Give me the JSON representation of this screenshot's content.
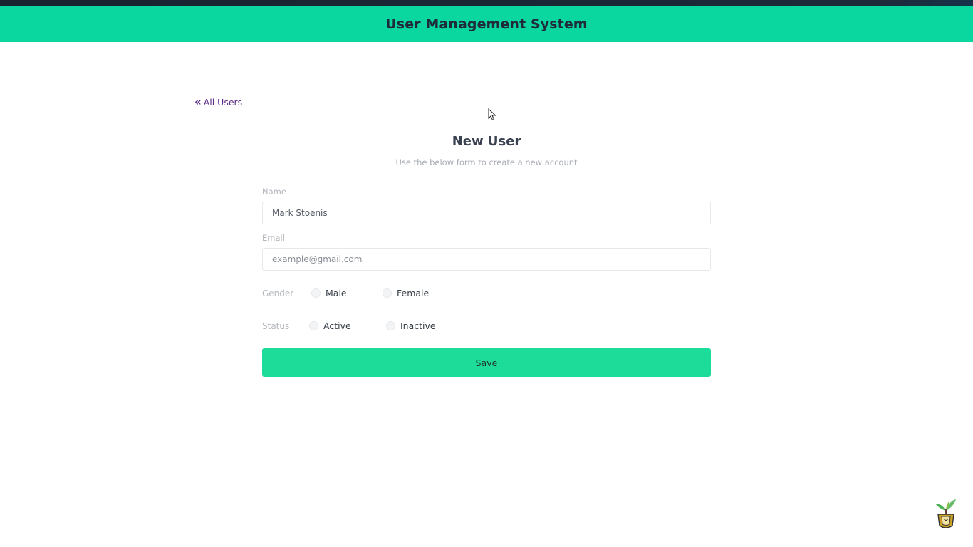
{
  "colors": {
    "header_bg": "#0ad6a0",
    "accent": "#1ddc9a",
    "link": "#5b2a86"
  },
  "header": {
    "title": "User Management System"
  },
  "nav": {
    "back_icon": "double-chevron-left-icon",
    "back_label": "All Users"
  },
  "form": {
    "title": "New User",
    "subtitle": "Use the below form to create a new account",
    "name": {
      "label": "Name",
      "value": "Mark Stoenis"
    },
    "email": {
      "label": "Email",
      "placeholder": "example@gmail.com"
    },
    "gender": {
      "label": "Gender",
      "options": [
        "Male",
        "Female"
      ]
    },
    "status": {
      "label": "Status",
      "options": [
        "Active",
        "Inactive"
      ]
    },
    "save_label": "Save"
  }
}
